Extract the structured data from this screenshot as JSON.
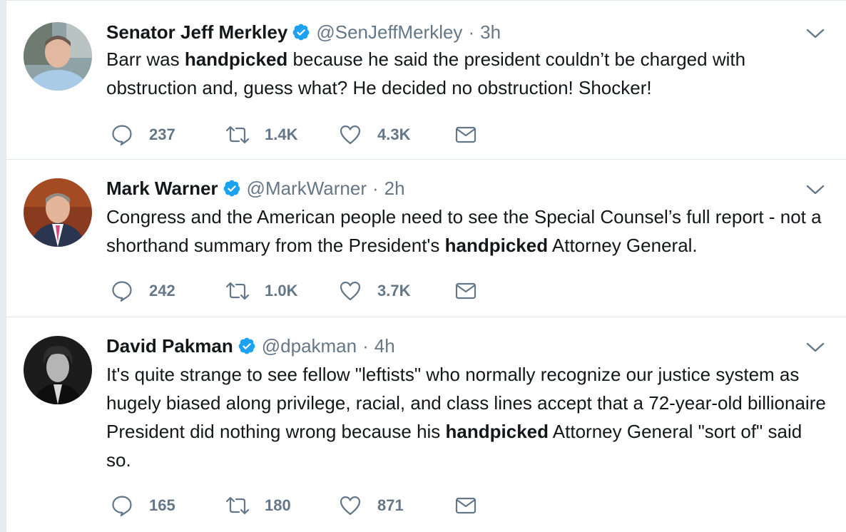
{
  "tweets": [
    {
      "name": "Senator Jeff Merkley",
      "handle": "@SenJeffMerkley",
      "separator": "·",
      "time": "3h",
      "text_before": "Barr was ",
      "text_bold": "handpicked",
      "text_after": " because he said the president couldn’t be charged with obstruction and, guess what? He decided no obstruction! Shocker!",
      "replies": "237",
      "retweets": "1.4K",
      "likes": "4.3K"
    },
    {
      "name": "Mark Warner",
      "handle": "@MarkWarner",
      "separator": "·",
      "time": "2h",
      "text_before": "Congress and the American people need to see the Special Counsel’s full report - not a shorthand summary from the President's ",
      "text_bold": "handpicked",
      "text_after": " Attorney General.",
      "replies": "242",
      "retweets": "1.0K",
      "likes": "3.7K"
    },
    {
      "name": "David Pakman",
      "handle": "@dpakman",
      "separator": "·",
      "time": "4h",
      "text_before": "It's quite strange to see fellow \"leftists\" who normally recognize our justice system as hugely biased along privilege, racial, and class lines accept that a 72-year-old billionaire President did nothing wrong because his ",
      "text_bold": "handpicked",
      "text_after": " Attorney General \"sort of\" said so.",
      "replies": "165",
      "retweets": "180",
      "likes": "871"
    }
  ],
  "icons": {
    "reply": "reply-icon",
    "retweet": "retweet-icon",
    "like": "heart-icon",
    "message": "direct-message-icon",
    "verified": "verified-badge-icon",
    "more": "chevron-down-icon"
  },
  "colors": {
    "verified": "#1da1f2",
    "muted": "#657786",
    "text": "#14171a",
    "border": "#e1e8ed"
  }
}
